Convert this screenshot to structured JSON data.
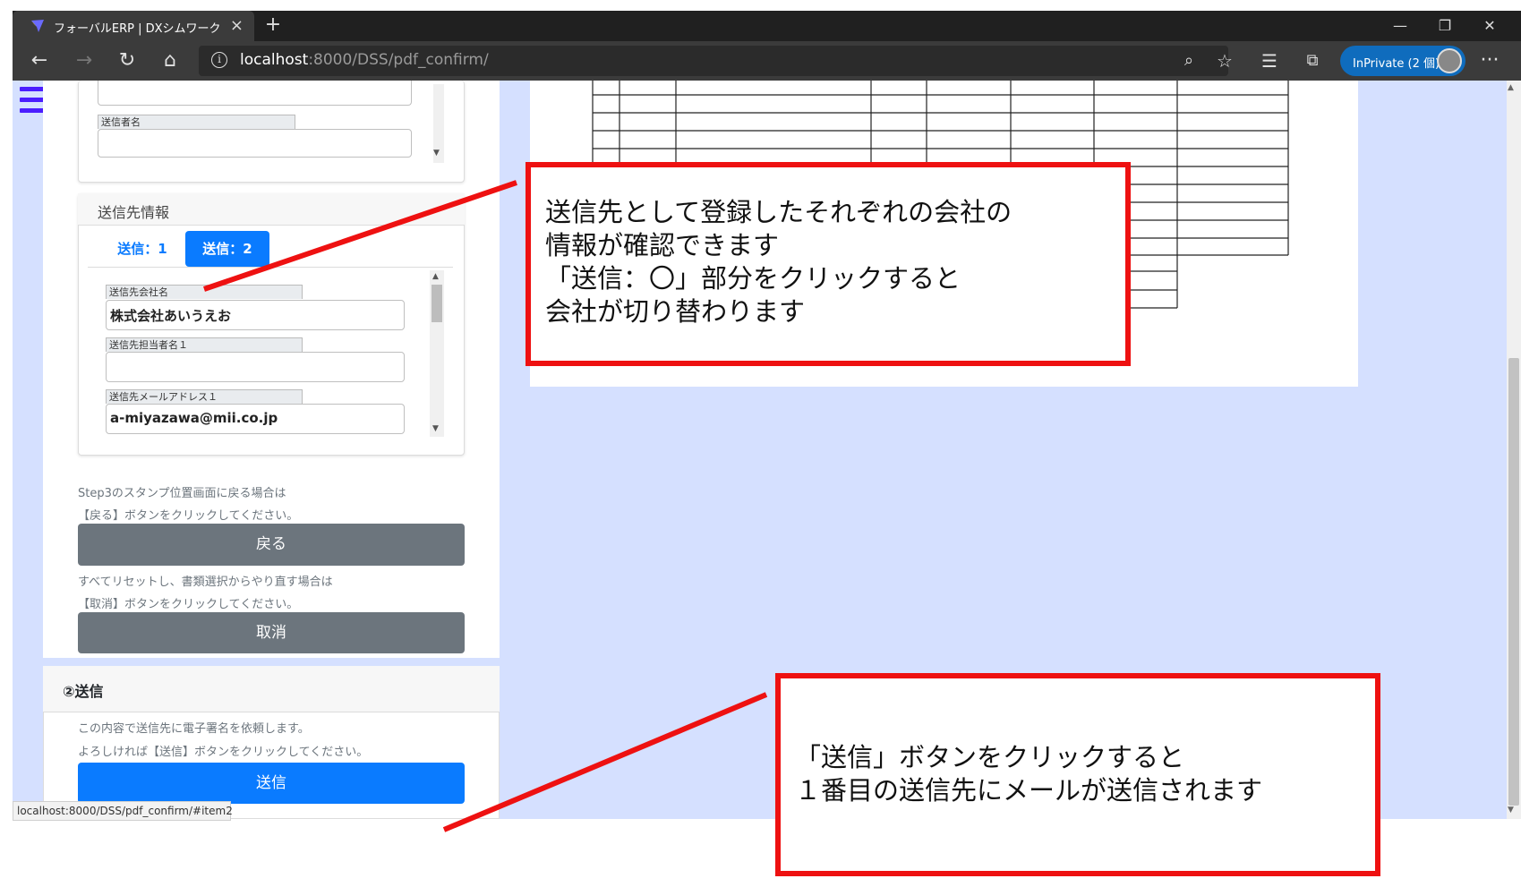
{
  "browser": {
    "tab_title": "フォーバルERP | DXシムワーク",
    "new_tab": "+",
    "url_host": "localhost",
    "url_rest": ":8000/DSS/pdf_confirm/",
    "inprivate_label": "InPrivate (2 個)",
    "minimize": "—",
    "restore": "❐",
    "close": "✕",
    "more": "···"
  },
  "sender_card": {
    "sender_name_label": "送信者名"
  },
  "recipient_card": {
    "title": "送信先情報",
    "tabs": [
      "送信：1",
      "送信：2"
    ],
    "active_tab": 1,
    "company_label": "送信先会社名",
    "company_value": "株式会社あいうえお",
    "contact_label": "送信先担当者名１",
    "contact_value": "",
    "email_label": "送信先メールアドレス１",
    "email_value": "a-miyazawa@mii.co.jp"
  },
  "actions": {
    "back_note_1": "Step3のスタンプ位置画面に戻る場合は",
    "back_note_2": "【戻る】ボタンをクリックしてください。",
    "back_button": "戻る",
    "cancel_note_1": "すべてリセットし、書類選択からやり直す場合は",
    "cancel_note_2": "【取消】ボタンをクリックしてください。",
    "cancel_button": "取消"
  },
  "send_section": {
    "title": "②送信",
    "note_1": "この内容で送信先に電子署名を依頼します。",
    "note_2": "よろしければ【送信】ボタンをクリックしてください。",
    "send_button": "送信"
  },
  "status_bar": "localhost:8000/DSS/pdf_confirm/#item2",
  "callouts": {
    "top": "送信先として登録したそれぞれの会社の\n情報が確認できます\n「送信：〇」部分をクリックすると\n会社が切り替わります",
    "bottom": "「送信」ボタンをクリックすると\n１番目の送信先にメールが送信されます"
  },
  "colors": {
    "accent_blue": "#0a7bff",
    "callout_red": "#ee1111",
    "page_bg": "#d5e0ff",
    "menu_purple": "#4b1dff"
  }
}
